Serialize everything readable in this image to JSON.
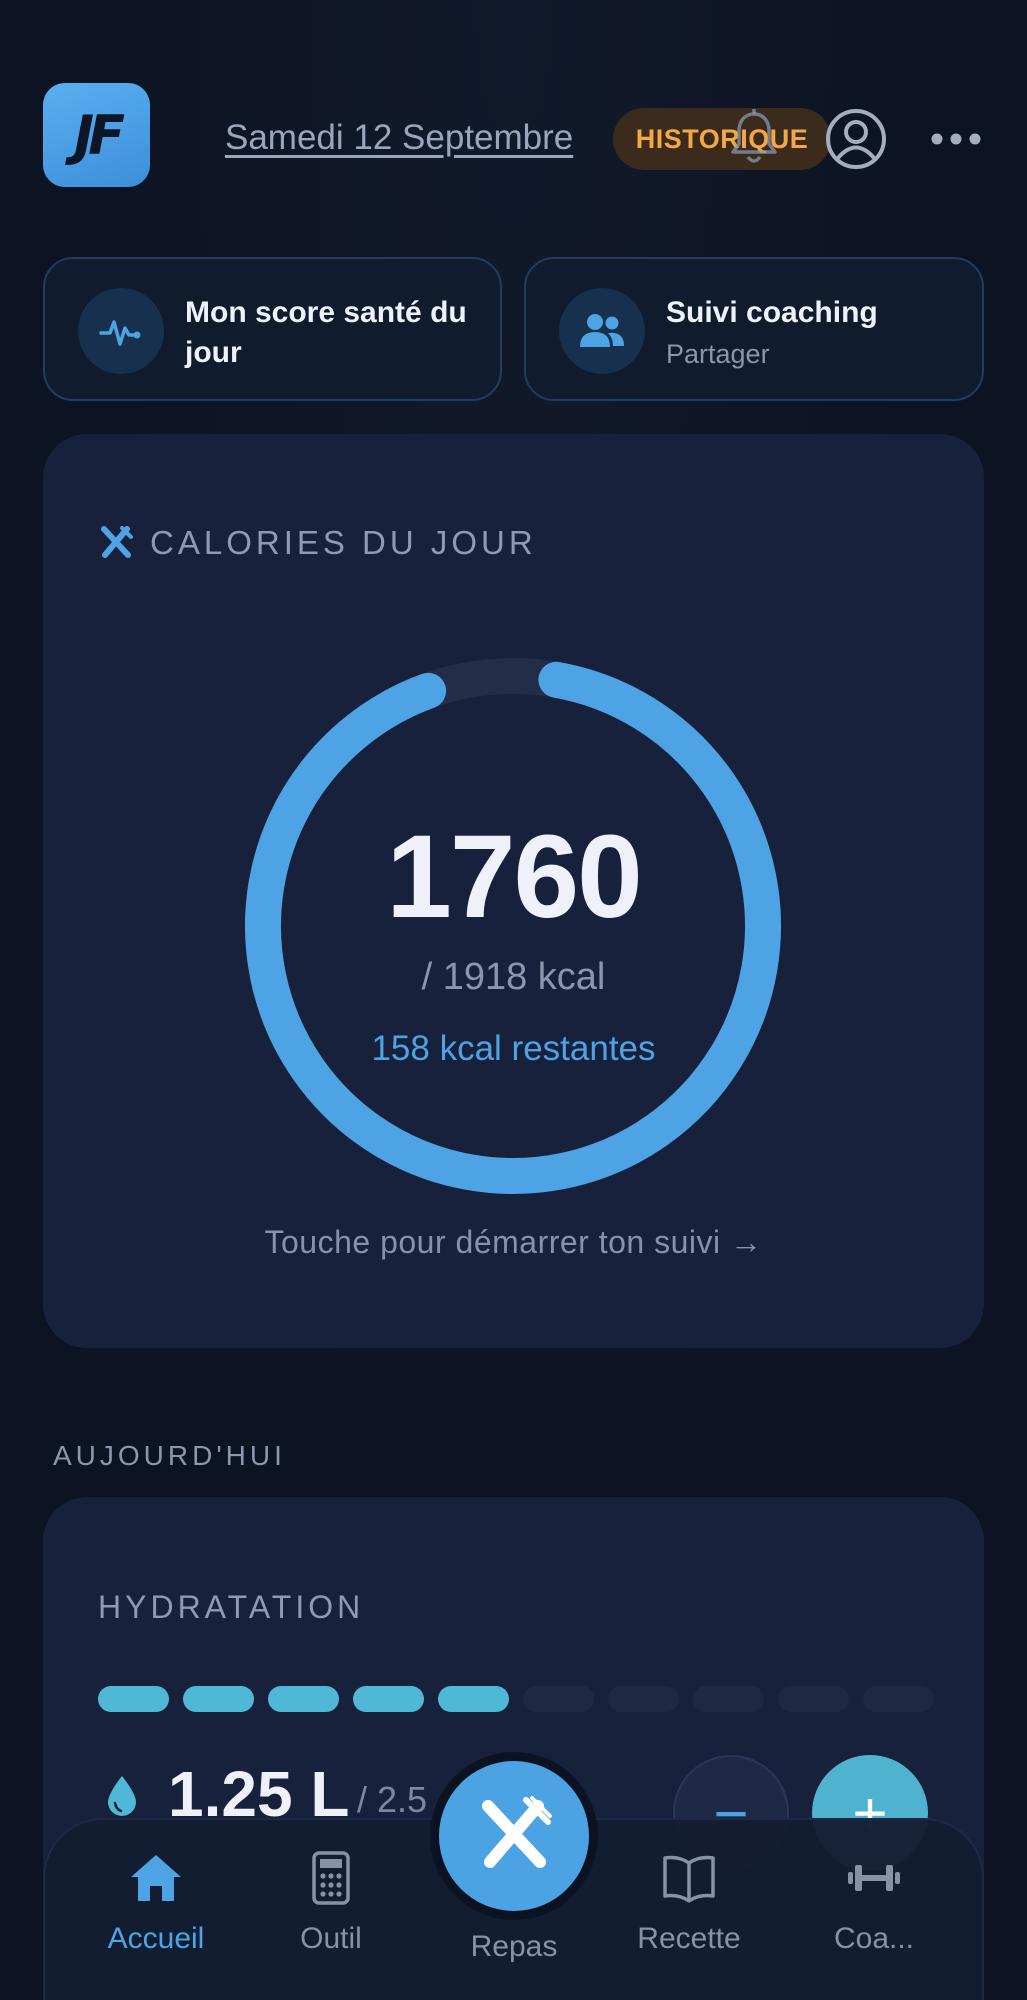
{
  "header": {
    "logo_text": "JF",
    "date": "Samedi 12 Septembre",
    "history_badge": "HISTORIQUE",
    "icons": [
      "bell-icon",
      "profile-icon",
      "more-icon"
    ]
  },
  "quick_actions": [
    {
      "title": "Mon score santé du jour",
      "subtitle": "",
      "icon": "heartbeat-icon"
    },
    {
      "title": "Suivi coaching",
      "subtitle": "Partager",
      "icon": "users-icon"
    }
  ],
  "calories": {
    "title": "CALORIES DU JOUR",
    "icon": "utensils-icon",
    "value": "1760",
    "goal": "/ 1918 kcal",
    "remaining": "158 kcal restantes",
    "progress": 0.917,
    "hint": "Touche pour démarrer ton suivi →"
  },
  "today": {
    "section_label": "AUJOURD'HUI"
  },
  "hydration": {
    "title": "HYDRATATION",
    "filled_glasses": 5,
    "total_glasses": 10,
    "amount": "1.25 L",
    "goal": "/ 2.5",
    "minus_label": "−",
    "plus_label": "+"
  },
  "nav": {
    "items": [
      {
        "label": "Accueil",
        "icon": "home-icon",
        "active": true
      },
      {
        "label": "Outil",
        "icon": "calculator-icon",
        "active": false
      },
      {
        "label": "Repas",
        "icon": "utensils-icon",
        "active": false
      },
      {
        "label": "Recette",
        "icon": "book-icon",
        "active": false
      },
      {
        "label": "Coa...",
        "icon": "dumbbell-icon",
        "active": false
      }
    ]
  },
  "colors": {
    "background": "#0c1322",
    "card": "#17213b",
    "accent_blue": "#4da3e3",
    "accent_teal": "#4fb8d6",
    "badge_orange": "#f3a845"
  }
}
